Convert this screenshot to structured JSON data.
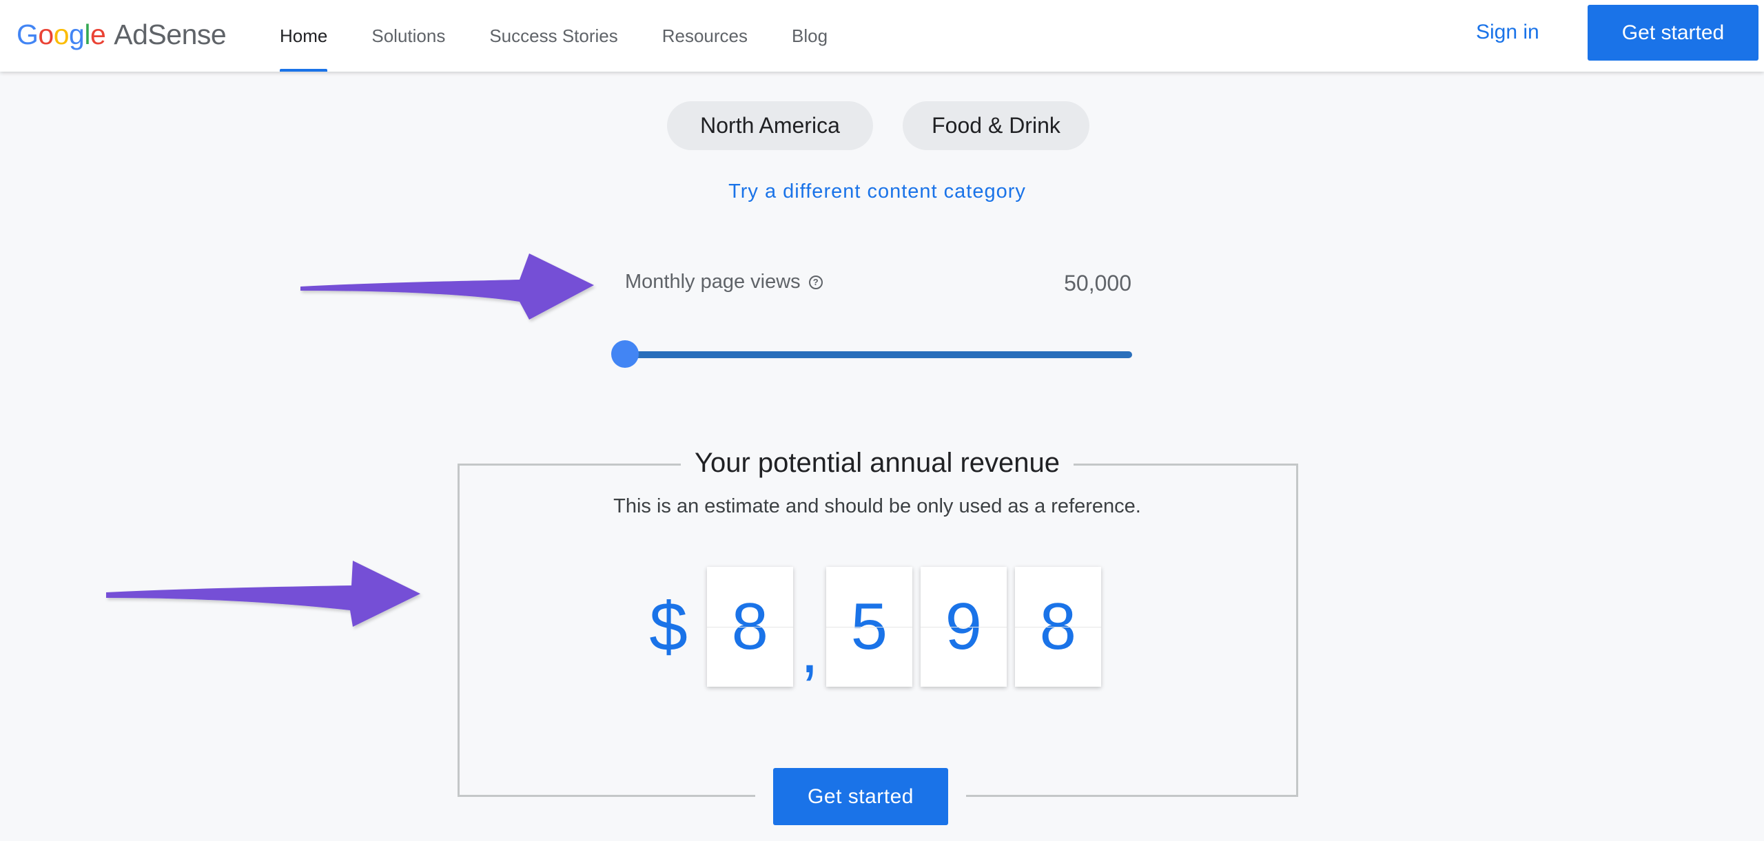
{
  "header": {
    "logo": {
      "letters": [
        {
          "ch": "G",
          "color": "#4285F4"
        },
        {
          "ch": "o",
          "color": "#EA4335"
        },
        {
          "ch": "o",
          "color": "#FBBC05"
        },
        {
          "ch": "g",
          "color": "#4285F4"
        },
        {
          "ch": "l",
          "color": "#34A853"
        },
        {
          "ch": "e",
          "color": "#EA4335"
        }
      ],
      "product": "AdSense"
    },
    "nav": [
      {
        "label": "Home",
        "active": true
      },
      {
        "label": "Solutions",
        "active": false
      },
      {
        "label": "Success Stories",
        "active": false
      },
      {
        "label": "Resources",
        "active": false
      },
      {
        "label": "Blog",
        "active": false
      }
    ],
    "sign_in": "Sign in",
    "cta": "Get started"
  },
  "calculator": {
    "region": "North America",
    "category": "Food & Drink",
    "change_category_link": "Try a different content category",
    "page_views": {
      "label": "Monthly page views",
      "help_icon": "question-circle-icon",
      "value": "50,000",
      "slider_fraction": 0
    }
  },
  "revenue": {
    "title": "Your potential annual revenue",
    "subtitle": "This is an estimate and should be only used as a reference.",
    "currency": "$",
    "digits": [
      "8",
      "5",
      "9",
      "8"
    ],
    "separator": ",",
    "cta": "Get started"
  },
  "annotations": {
    "arrow_icon": "arrow-right-icon",
    "arrow_color": "#7450d6"
  },
  "colors": {
    "accent": "#1a73e8",
    "page_bg": "#f7f8fa"
  }
}
